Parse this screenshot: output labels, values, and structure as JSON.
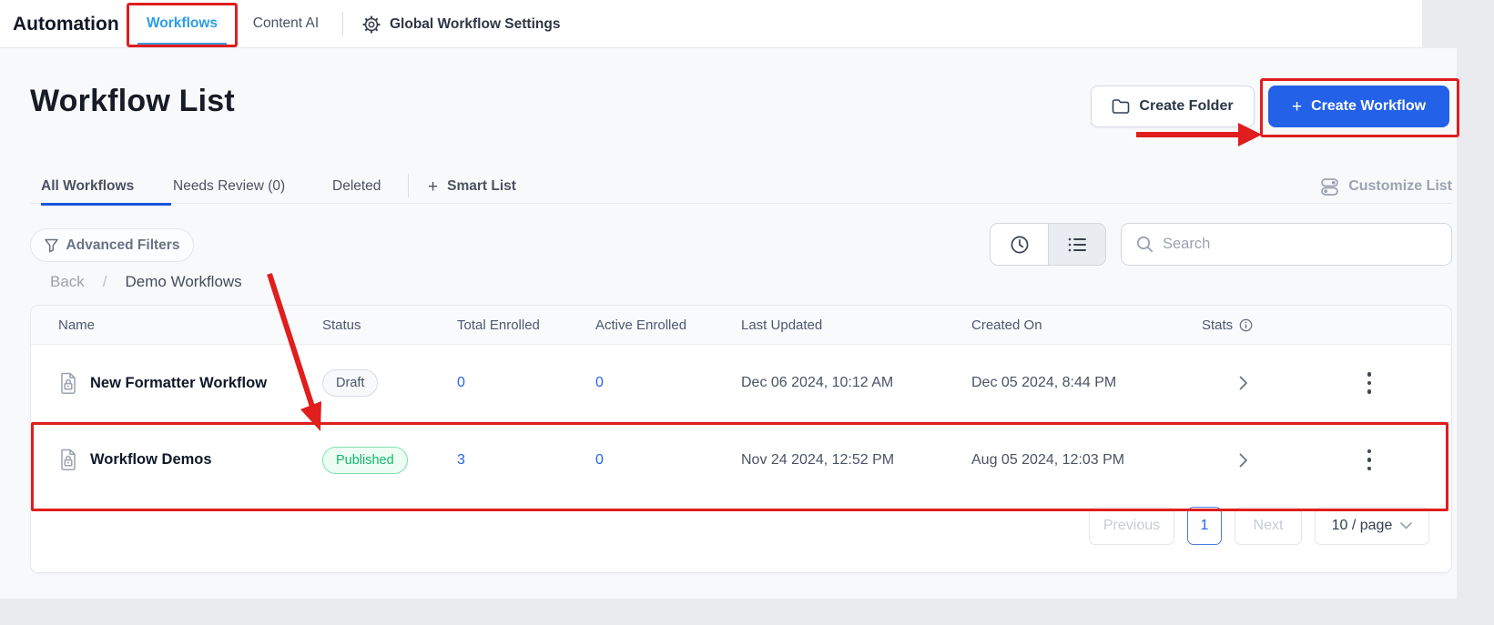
{
  "topnav": {
    "brand": "Automation",
    "workflows_tab": "Workflows",
    "content_ai_tab": "Content AI",
    "settings_label": "Global Workflow Settings"
  },
  "header": {
    "title": "Workflow List",
    "create_folder_label": "Create Folder",
    "create_workflow_plus": "+",
    "create_workflow_label": "Create Workflow"
  },
  "tabs": {
    "all_workflows": "All Workflows",
    "needs_review": "Needs Review (0)",
    "deleted": "Deleted",
    "smart_list_plus": "+",
    "smart_list": "Smart List",
    "customize_list": "Customize List"
  },
  "filters": {
    "advanced_label": "Advanced Filters",
    "search_placeholder": "Search"
  },
  "breadcrumb": {
    "back": "Back",
    "separator": "/",
    "current": "Demo Workflows"
  },
  "table": {
    "columns": [
      "Name",
      "Status",
      "Total Enrolled",
      "Active Enrolled",
      "Last Updated",
      "Created On",
      "Stats"
    ],
    "rows": [
      {
        "name": "New Formatter Workflow",
        "status": "Draft",
        "total_enrolled": "0",
        "active_enrolled": "0",
        "last_updated": "Dec 06 2024, 10:12 AM",
        "created_on": "Dec 05 2024, 8:44 PM"
      },
      {
        "name": "Workflow Demos",
        "status": "Published",
        "total_enrolled": "3",
        "active_enrolled": "0",
        "last_updated": "Nov 24 2024, 12:52 PM",
        "created_on": "Aug 05 2024, 12:03 PM"
      }
    ]
  },
  "pagination": {
    "previous": "Previous",
    "page": "1",
    "next": "Next",
    "page_size": "10 / page"
  },
  "colors": {
    "primary_button_blue": "#2361e8",
    "active_tab_blue": "#1a56db",
    "topnav_active_blue": "#2b9ce8",
    "link_blue": "#2563eb",
    "published_green": "#12b76a",
    "annotation_red": "#e01e1e",
    "page_background": "#f8f9fb"
  }
}
